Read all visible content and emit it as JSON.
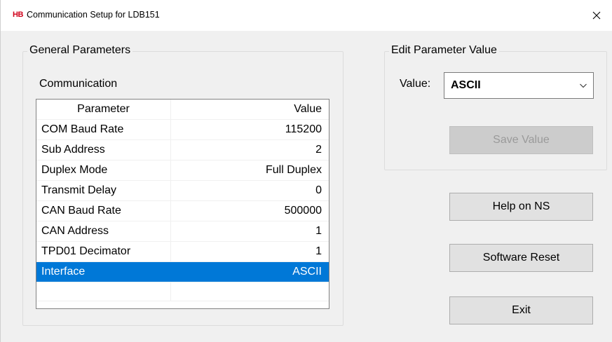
{
  "window": {
    "logo": "HB",
    "title": "Communication Setup for LDB151"
  },
  "general": {
    "legend": "General Parameters",
    "section": "Communication",
    "columns": [
      "Parameter",
      "Value"
    ],
    "rows": [
      {
        "parameter": "COM Baud Rate",
        "value": "115200"
      },
      {
        "parameter": "Sub Address",
        "value": "2"
      },
      {
        "parameter": "Duplex Mode",
        "value": "Full Duplex"
      },
      {
        "parameter": "Transmit Delay",
        "value": "0"
      },
      {
        "parameter": "CAN Baud Rate",
        "value": "500000"
      },
      {
        "parameter": "CAN Address",
        "value": "1"
      },
      {
        "parameter": "TPD01 Decimator",
        "value": "1"
      },
      {
        "parameter": "Interface",
        "value": "ASCII"
      }
    ],
    "selected_row": "Interface"
  },
  "edit": {
    "legend": "Edit Parameter Value",
    "value_label": "Value:",
    "selected_value": "ASCII",
    "save_label": "Save Value"
  },
  "buttons": {
    "help": "Help on NS",
    "reset": "Software Reset",
    "exit": "Exit"
  },
  "colors": {
    "selection": "#0078d7",
    "logo": "#d0021b"
  },
  "icons": {
    "close": "close-icon",
    "dropdown": "chevron-down-icon"
  }
}
